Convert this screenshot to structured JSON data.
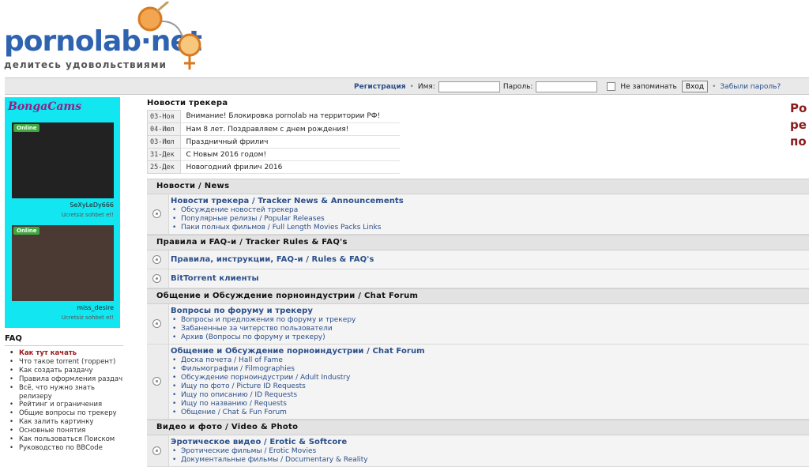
{
  "logo": {
    "text": "pornolab·net",
    "tagline": "делитесь удовольствиями"
  },
  "loginbar": {
    "register": "Регистрация",
    "name_label": "Имя:",
    "password_label": "Пароль:",
    "remember_label": "Не запоминать",
    "login_button": "Вход",
    "forgot": "Забыли пароль?"
  },
  "ad": {
    "brand": "BongaCams",
    "badge": "Online",
    "cams": [
      {
        "name": "SeXyLeDy666",
        "sub": "Ucretsiz sohbet et!"
      },
      {
        "name": "miss_desire",
        "sub": "Ucretsiz sohbet et!"
      }
    ]
  },
  "faq": {
    "title": "FAQ",
    "items": [
      "Как тут качать",
      "Что такое torrent (торрент)",
      "Как создать раздачу",
      "Правила оформления раздач",
      "Всё, что нужно знать релизеру",
      "Рейтинг и ограничения",
      "Общие вопросы по трекеру",
      "Как залить картинку",
      "Основные понятия",
      "Как пользоваться Поиском",
      "Руководство по BBCode"
    ]
  },
  "news": {
    "title": "Новости трекера",
    "items": [
      {
        "date": "03-Ноя",
        "text": "Внимание! Блокировка pornolab на территории РФ!"
      },
      {
        "date": "04-Июл",
        "text": "Нам 8 лет. Поздравляем с днем рождения!"
      },
      {
        "date": "03-Июл",
        "text": "Праздничный фрилич"
      },
      {
        "date": "31-Дек",
        "text": "С Новым 2016 годом!"
      },
      {
        "date": "25-Дек",
        "text": "Новогодний фрилич 2016"
      }
    ]
  },
  "promo": {
    "lines": [
      "Ро",
      "ре",
      "по"
    ]
  },
  "forum": {
    "categories": [
      {
        "title": "Новости / News",
        "forums": [
          {
            "name": "Новости трекера / Tracker News & Announcements",
            "subs": [
              "Обсуждение новостей трекера",
              "Популярные релизы / Popular Releases",
              "Паки полных фильмов / Full Length Movies Packs Links"
            ]
          }
        ]
      },
      {
        "title": "Правила и FAQ-и / Tracker Rules & FAQ's",
        "forums": [
          {
            "name": "Правила, инструкции, FAQ-и / Rules & FAQ's",
            "subs": []
          },
          {
            "name": "BitTorrent клиенты",
            "subs": []
          }
        ]
      },
      {
        "title": "Общение и Обсуждение порноиндустрии / Chat Forum",
        "forums": [
          {
            "name": "Вопросы по форуму и трекеру",
            "subs": [
              "Вопросы и предложения по форуму и трекеру",
              "Забаненные за читерство пользователи",
              "Архив (Вопросы по форуму и трекеру)"
            ]
          },
          {
            "name": "Общение и Обсуждение порноиндустрии / Chat Forum",
            "subs": [
              "Доска почета / Hall of Fame",
              "Фильмографии / Filmographies",
              "Обсуждение порноиндустрии / Adult Industry",
              "Ищу по фото / Picture ID Requests",
              "Ищу по описанию / ID Requests",
              "Ищу по названию / Requests",
              "Общение / Chat & Fun Forum"
            ]
          }
        ]
      },
      {
        "title": "Видео и фото / Video & Photo",
        "forums": [
          {
            "name": "Эротическое видео / Erotic & Softcore",
            "subs": [
              "Эротические фильмы / Erotic Movies",
              "Документальные фильмы / Documentary & Reality"
            ]
          }
        ]
      }
    ]
  }
}
